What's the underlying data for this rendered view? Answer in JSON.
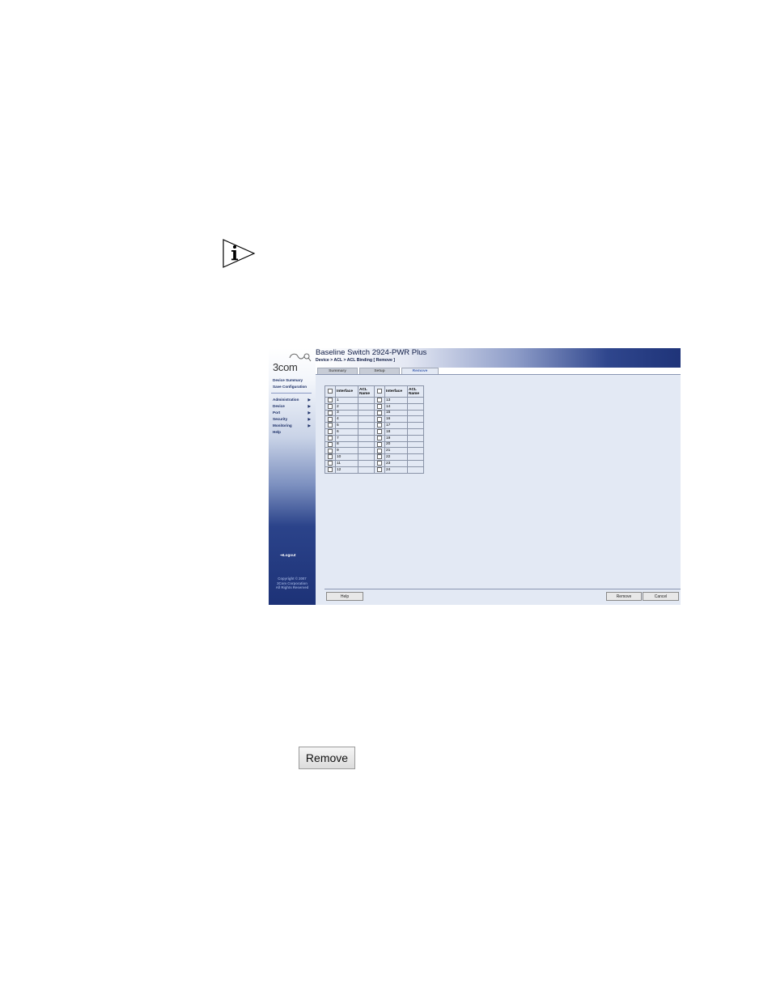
{
  "app": {
    "logo_text": "3com",
    "title": "Baseline Switch 2924-PWR Plus",
    "breadcrumb": "Device > ACL > ACL Binding [ Remove ]"
  },
  "sidebar": {
    "top_links": [
      "Device Summary",
      "Save Configuration"
    ],
    "menu": [
      {
        "label": "Administration",
        "has_submenu": true
      },
      {
        "label": "Device",
        "has_submenu": true
      },
      {
        "label": "Port",
        "has_submenu": true
      },
      {
        "label": "Security",
        "has_submenu": true
      },
      {
        "label": "Monitoring",
        "has_submenu": true
      },
      {
        "label": "Help",
        "has_submenu": false
      }
    ],
    "logout": "Logout",
    "copyright": [
      "Copyright © 2007",
      "3Com Corporation",
      "All Rights Reserved"
    ]
  },
  "tabs": [
    {
      "label": "Summary",
      "active": false
    },
    {
      "label": "Setup",
      "active": false
    },
    {
      "label": "Remove",
      "active": true
    }
  ],
  "table": {
    "headers": {
      "interface": "Interface",
      "acl_name": "ACL Name"
    },
    "left_interfaces": [
      "1",
      "2",
      "3",
      "4",
      "5",
      "6",
      "7",
      "8",
      "9",
      "10",
      "11",
      "12"
    ],
    "right_interfaces": [
      "13",
      "14",
      "15",
      "16",
      "17",
      "18",
      "19",
      "20",
      "21",
      "22",
      "23",
      "24"
    ]
  },
  "buttons": {
    "help": "Help",
    "remove": "Remove",
    "cancel": "Cancel"
  },
  "standalone_button": "Remove",
  "colors": {
    "banner_dark": "#1f3479",
    "sidebar_dark": "#1d3277",
    "content_bg": "#e3e9f4",
    "active_tab_text": "#4a69b5"
  }
}
